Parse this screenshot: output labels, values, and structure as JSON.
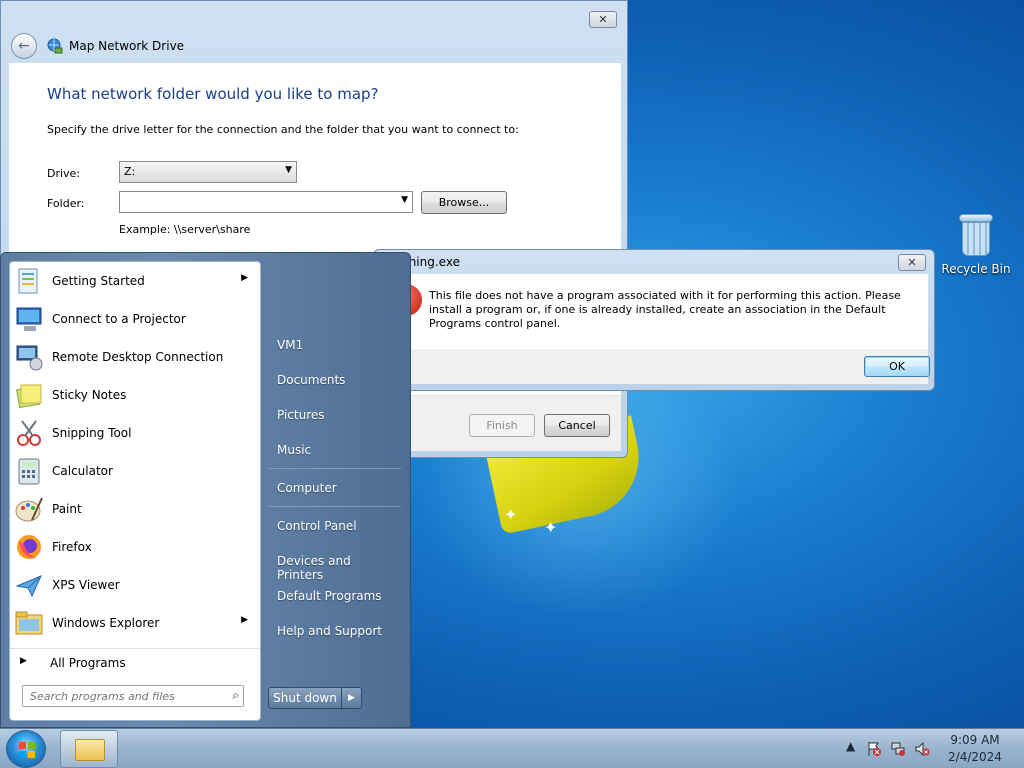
{
  "desktop": {
    "recycle_bin_label": "Recycle Bin"
  },
  "map_drive": {
    "title": "Map Network Drive",
    "close_label": "✕",
    "heading": "What network folder would you like to map?",
    "instructions": "Specify the drive letter for the connection and the folder that you want to connect to:",
    "drive_label": "Drive:",
    "drive_value": "Z:",
    "folder_label": "Folder:",
    "folder_value": "",
    "browse_label": "Browse...",
    "example": "Example: \\\\server\\share",
    "finish_label": "Finish",
    "cancel_label": "Cancel"
  },
  "error_dialog": {
    "title": "thing.exe",
    "close_label": "✕",
    "message": "This file does not have a program associated with it for performing this action. Please install a program or, if one is already installed, create an association in the Default Programs control panel.",
    "ok_label": "OK"
  },
  "start_menu": {
    "programs": [
      {
        "label": "Getting Started",
        "has_submenu": true
      },
      {
        "label": "Connect to a Projector",
        "has_submenu": false
      },
      {
        "label": "Remote Desktop Connection",
        "has_submenu": false
      },
      {
        "label": "Sticky Notes",
        "has_submenu": false
      },
      {
        "label": "Snipping Tool",
        "has_submenu": false
      },
      {
        "label": "Calculator",
        "has_submenu": false
      },
      {
        "label": "Paint",
        "has_submenu": false
      },
      {
        "label": "Firefox",
        "has_submenu": false
      },
      {
        "label": "XPS Viewer",
        "has_submenu": false
      },
      {
        "label": "Windows Explorer",
        "has_submenu": true
      }
    ],
    "all_programs": "All Programs",
    "search_placeholder": "Search programs and files",
    "right_items": [
      "VM1",
      "Documents",
      "Pictures",
      "Music",
      "Computer",
      "Control Panel",
      "Devices and Printers",
      "Default Programs",
      "Help and Support"
    ],
    "shutdown_label": "Shut down"
  },
  "taskbar": {
    "time": "9:09 AM",
    "date": "2/4/2024"
  }
}
